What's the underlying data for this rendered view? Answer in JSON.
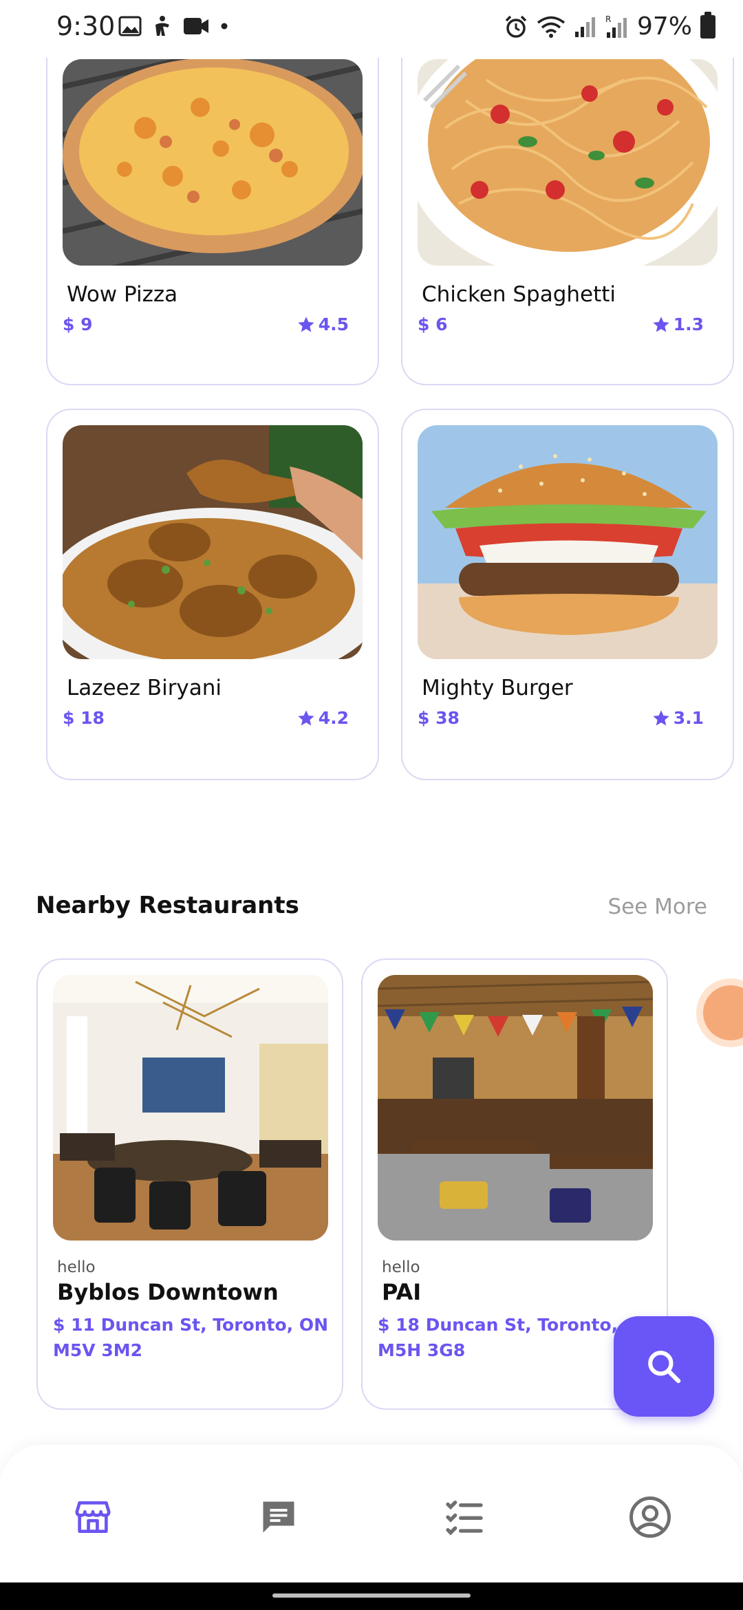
{
  "status_bar": {
    "time": "9:30",
    "battery_pct": "97%"
  },
  "food_items": [
    {
      "name": "Wow Pizza",
      "price": "$ 9",
      "rating": "4.5"
    },
    {
      "name": "Chicken Spaghetti",
      "price": "$ 6",
      "rating": "1.3"
    },
    {
      "name": "Lazeez Biryani",
      "price": "$ 18",
      "rating": "4.2"
    },
    {
      "name": "Mighty Burger",
      "price": "$ 38",
      "rating": "3.1"
    }
  ],
  "nearby": {
    "title": "Nearby Restaurants",
    "see_more": "See More",
    "items": [
      {
        "tag": "hello",
        "name": "Byblos Downtown",
        "address": "$ 11 Duncan St, Toronto, ON M5V 3M2"
      },
      {
        "tag": "hello",
        "name": "PAI",
        "address": "$ 18 Duncan St, Toronto, ON M5H 3G8"
      }
    ]
  },
  "nav": {
    "items": [
      "store-icon",
      "chat-icon",
      "checklist-icon",
      "account-icon"
    ],
    "active_index": 0
  },
  "colors": {
    "accent": "#6a55f0",
    "card_border": "#dcd8f4",
    "inactive_icon": "#6f6f6f"
  }
}
